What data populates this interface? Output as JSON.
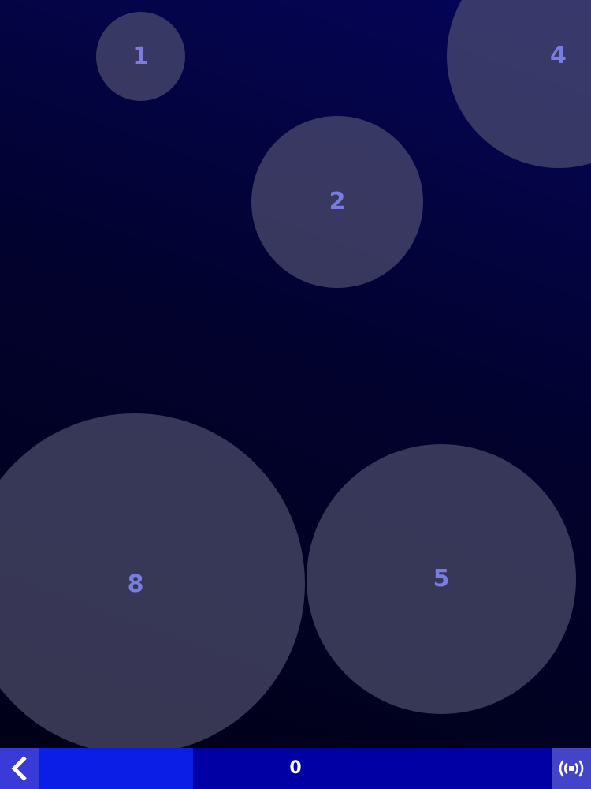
{
  "bubbles": [
    {
      "id": "b1",
      "label": "1"
    },
    {
      "id": "b2",
      "label": "2"
    },
    {
      "id": "b4",
      "label": "4"
    },
    {
      "id": "b8",
      "label": "8"
    },
    {
      "id": "b5",
      "label": "5"
    }
  ],
  "bottom_bar": {
    "score": "0",
    "progress_fraction": 0.3,
    "back_icon": "chevron-left-icon",
    "sound_icon": "broadcast-icon"
  },
  "colors": {
    "bar_background": "#0000a4",
    "progress_fill": "#0a1ee6",
    "bubble_text": "#7a7de0",
    "bubble_fill": "#585878"
  }
}
